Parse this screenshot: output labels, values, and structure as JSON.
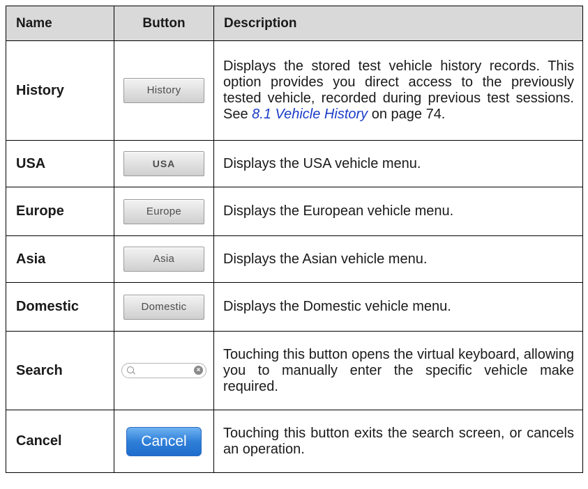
{
  "headers": {
    "name": "Name",
    "button": "Button",
    "description": "Description"
  },
  "rows": [
    {
      "name": "History",
      "button_label": "History",
      "desc_pre": "Displays the stored test vehicle history records. This option provides you direct access to the previously tested vehicle, recorded during previous test sessions. See ",
      "desc_link": "8.1 Vehicle History",
      "desc_post": " on page 74."
    },
    {
      "name": "USA",
      "button_label": "USA",
      "description": "Displays the USA vehicle menu."
    },
    {
      "name": "Europe",
      "button_label": "Europe",
      "description": "Displays the European vehicle menu."
    },
    {
      "name": "Asia",
      "button_label": "Asia",
      "description": "Displays the Asian vehicle menu."
    },
    {
      "name": "Domestic",
      "button_label": "Domestic",
      "description": "Displays the Domestic vehicle menu."
    },
    {
      "name": "Search",
      "button_icon": "search-field-icon",
      "description": "Touching this button opens the virtual keyboard, allowing you to manually enter the specific vehicle make required."
    },
    {
      "name": "Cancel",
      "button_label": "Cancel",
      "description": "Touching this button exits the search screen, or cancels an operation."
    }
  ],
  "colors": {
    "header_bg": "#d9d9d9",
    "link": "#1a3cc8",
    "cancel_button": "#2f7fd8"
  }
}
